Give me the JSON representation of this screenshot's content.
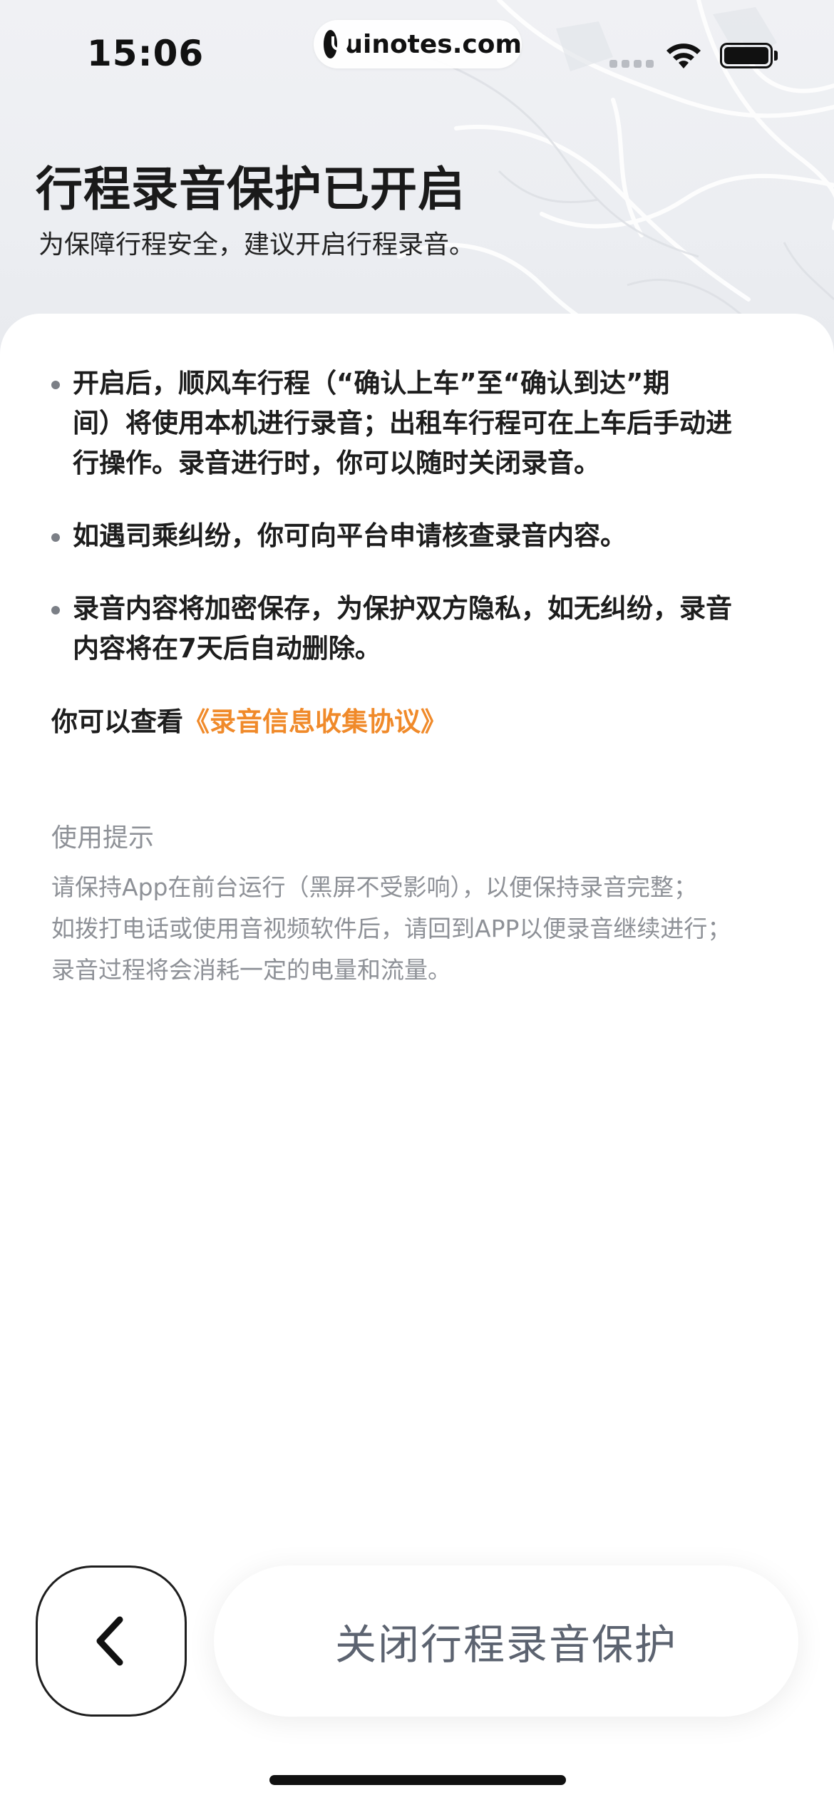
{
  "status_bar": {
    "time": "15:06",
    "url": "uinotes.com"
  },
  "header": {
    "title": "行程录音保护已开启",
    "subtitle": "为保障行程安全，建议开启行程录音。"
  },
  "bullets": [
    {
      "line1": "开启后，顺风车行程（“确认上车”至“确认到达”期",
      "line2": "间）将使用本机进行录音；出租车行程可在上车后手动进",
      "line3": "行操作。录音进行时，你可以随时关闭录音。"
    },
    {
      "line1": "如遇司乘纠纷，你可向平台申请核查录音内容。"
    },
    {
      "line1": "录音内容将加密保存，为保护双方隐私，如无纠纷，录音",
      "line2": "内容将在7天后自动删除。"
    }
  ],
  "agreement": {
    "prefix": "你可以查看",
    "link": "《录音信息收集协议》"
  },
  "tips": {
    "title": "使用提示",
    "lines": [
      "请保持App在前台运行（黑屏不受影响），以便保持录音完整；",
      "如拨打电话或使用音视频软件后，请回到APP以便录音继续进行；",
      "录音过程将会消耗一定的电量和流量。"
    ]
  },
  "actions": {
    "back_icon": "chevron-left-icon",
    "close_label": "关闭行程录音保护"
  },
  "colors": {
    "link": "#f08a2a",
    "tips_text": "#8e9197",
    "button_text": "#5c6370"
  }
}
